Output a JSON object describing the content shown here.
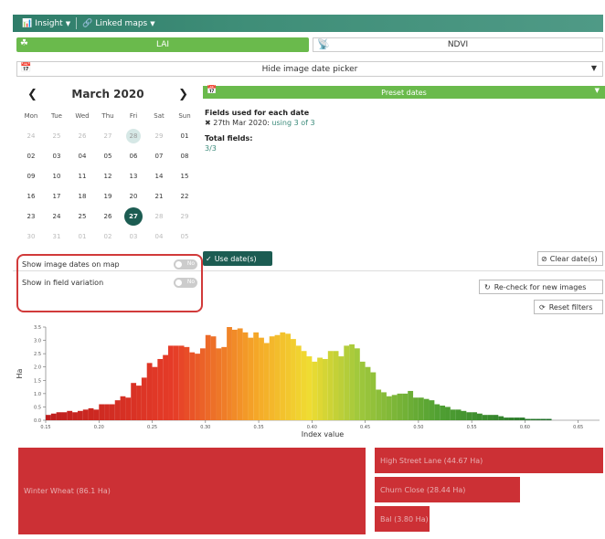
{
  "topbar": {
    "insight_label": "Insight",
    "linked_maps_label": "Linked maps"
  },
  "layer_toggle": {
    "lai_label": "LAI",
    "ndvi_label": "NDVI",
    "active": "LAI"
  },
  "date_picker_bar": {
    "label": "Hide image date picker"
  },
  "calendar": {
    "month_label": "March 2020",
    "day_names": [
      "Mon",
      "Tue",
      "Wed",
      "Thu",
      "Fri",
      "Sat",
      "Sun"
    ],
    "weeks": [
      [
        {
          "d": "24",
          "m": true
        },
        {
          "d": "25",
          "m": true
        },
        {
          "d": "26",
          "m": true
        },
        {
          "d": "27",
          "m": true
        },
        {
          "d": "28",
          "m": true,
          "hl": true
        },
        {
          "d": "29",
          "m": true
        },
        {
          "d": "01"
        }
      ],
      [
        {
          "d": "02"
        },
        {
          "d": "03"
        },
        {
          "d": "04"
        },
        {
          "d": "05"
        },
        {
          "d": "06"
        },
        {
          "d": "07"
        },
        {
          "d": "08"
        }
      ],
      [
        {
          "d": "09"
        },
        {
          "d": "10"
        },
        {
          "d": "11"
        },
        {
          "d": "12"
        },
        {
          "d": "13"
        },
        {
          "d": "14"
        },
        {
          "d": "15"
        }
      ],
      [
        {
          "d": "16"
        },
        {
          "d": "17"
        },
        {
          "d": "18"
        },
        {
          "d": "19"
        },
        {
          "d": "20"
        },
        {
          "d": "21"
        },
        {
          "d": "22"
        }
      ],
      [
        {
          "d": "23"
        },
        {
          "d": "24"
        },
        {
          "d": "25"
        },
        {
          "d": "26"
        },
        {
          "d": "27",
          "sel": true
        },
        {
          "d": "28",
          "m": true
        },
        {
          "d": "29",
          "m": true
        }
      ],
      [
        {
          "d": "30",
          "m": true
        },
        {
          "d": "31",
          "m": true
        },
        {
          "d": "01",
          "m": true
        },
        {
          "d": "02",
          "m": true
        },
        {
          "d": "03",
          "m": true
        },
        {
          "d": "04",
          "m": true
        },
        {
          "d": "05",
          "m": true
        }
      ]
    ]
  },
  "preset": {
    "label": "Preset dates"
  },
  "info": {
    "fields_title": "Fields used for each date",
    "date_line_prefix": "27th Mar 2020:",
    "date_line_usage": "using 3 of 3",
    "total_title": "Total fields:",
    "total_value": "3/3"
  },
  "actions": {
    "use_dates": "Use date(s)",
    "clear_dates": "Clear date(s)",
    "recheck": "Re-check for new images",
    "reset_filters": "Reset filters"
  },
  "options": {
    "show_image_dates": "Show image dates on map",
    "show_field_variation": "Show in field variation",
    "switch_off_label": "No"
  },
  "chart_data": {
    "type": "bar",
    "xlabel": "Index value",
    "ylabel": "Ha",
    "ylim": [
      0,
      3.5
    ],
    "yticks": [
      "0.0",
      "0.5",
      "1.0",
      "1.5",
      "2.0",
      "2.5",
      "3.0",
      "3.5"
    ],
    "xticks": [
      "0.15",
      "0.20",
      "0.25",
      "0.30",
      "0.35",
      "0.40",
      "0.45",
      "0.50",
      "0.55",
      "0.60",
      "0.65"
    ],
    "xlim": [
      0.15,
      0.67
    ],
    "bin_width": 0.005,
    "x_start": 0.15,
    "values": [
      0.2,
      0.25,
      0.3,
      0.3,
      0.35,
      0.3,
      0.35,
      0.4,
      0.45,
      0.4,
      0.6,
      0.6,
      0.6,
      0.75,
      0.9,
      0.85,
      1.4,
      1.3,
      1.6,
      2.15,
      2.0,
      2.3,
      2.45,
      2.8,
      2.8,
      2.8,
      2.75,
      2.55,
      2.5,
      2.7,
      3.2,
      3.15,
      2.7,
      2.75,
      3.5,
      3.4,
      3.45,
      3.3,
      3.1,
      3.3,
      3.1,
      2.9,
      3.15,
      3.2,
      3.3,
      3.25,
      3.05,
      2.8,
      2.6,
      2.4,
      2.2,
      2.35,
      2.3,
      2.6,
      2.6,
      2.4,
      2.8,
      2.85,
      2.7,
      2.2,
      2.0,
      1.8,
      1.15,
      1.05,
      0.9,
      0.95,
      1.0,
      1.0,
      1.1,
      0.85,
      0.85,
      0.8,
      0.75,
      0.6,
      0.55,
      0.5,
      0.4,
      0.4,
      0.35,
      0.3,
      0.3,
      0.25,
      0.2,
      0.2,
      0.2,
      0.15,
      0.1,
      0.1,
      0.1,
      0.1,
      0.05,
      0.05,
      0.05,
      0.05,
      0.05
    ]
  },
  "crop_breakdown": [
    {
      "label": "Winter Wheat (86.1 Ha)",
      "value": 86.1
    },
    {
      "label": "High Street Lane (44.67 Ha)",
      "value": 44.67
    },
    {
      "label": "Churn Close (28.44 Ha)",
      "value": 28.44
    },
    {
      "label": "Bal (3.80 Ha)",
      "value": 3.8
    }
  ]
}
